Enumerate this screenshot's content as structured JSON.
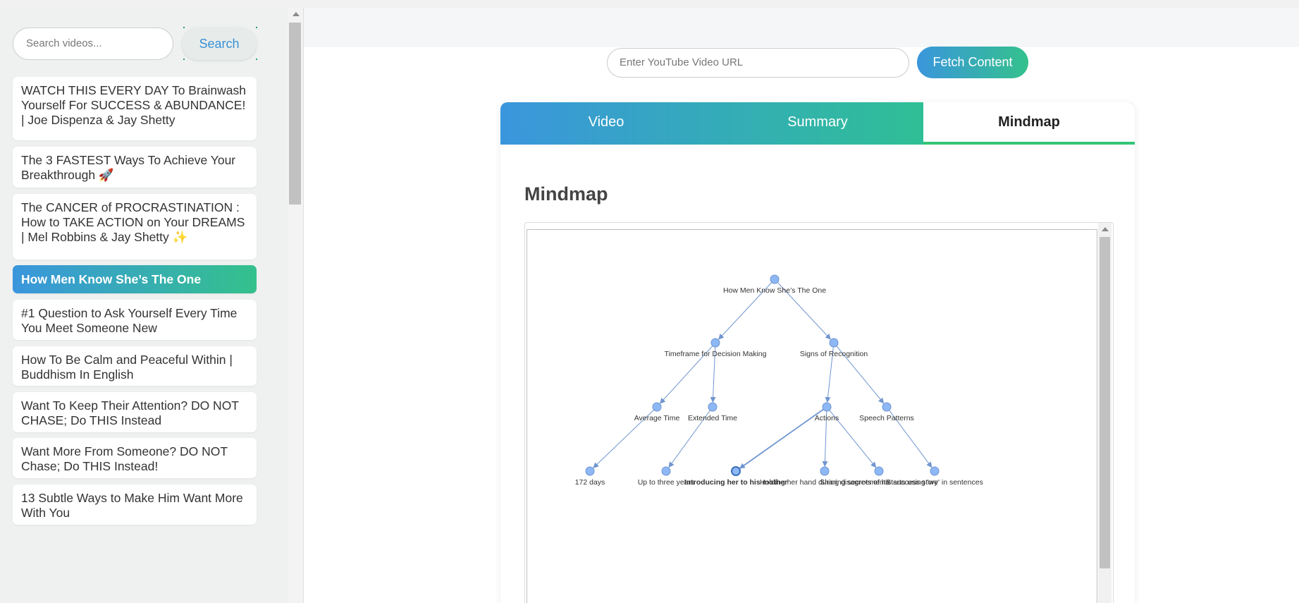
{
  "sidebar": {
    "search_placeholder": "Search videos...",
    "search_label": "Search",
    "videos": [
      "WATCH THIS EVERY DAY To Brainwash Yourself For SUCCESS & ABUNDANCE! | Joe Dispenza & Jay Shetty",
      "The 3 FASTEST Ways To Achieve Your Breakthrough 🚀",
      "The CANCER of PROCRASTINATION : How to TAKE ACTION on Your DREAMS | Mel Robbins & Jay Shetty ✨",
      "How Men Know She’s The One",
      "#1 Question to Ask Yourself Every Time You Meet Someone New",
      "How To Be Calm and Peaceful Within | Buddhism In English",
      "Want To Keep Their Attention? DO NOT CHASE; Do THIS Instead",
      "Want More From Someone? DO NOT Chase; Do THIS Instead!",
      "13 Subtle Ways to Make Him Want More With You"
    ],
    "active_index": 3
  },
  "main": {
    "url_placeholder": "Enter YouTube Video URL",
    "fetch_label": "Fetch Content",
    "tabs": [
      "Video",
      "Summary",
      "Mindmap"
    ],
    "active_tab": "Mindmap",
    "section_title": "Mindmap"
  },
  "mindmap": {
    "root": "How Men Know She’s The One",
    "branches": [
      {
        "label": "Timeframe for Decision Making",
        "children": [
          {
            "label": "Average Time",
            "children": [
              "172 days"
            ]
          },
          {
            "label": "Extended Time",
            "children": [
              "Up to three years"
            ]
          }
        ]
      },
      {
        "label": "Signs of Recognition",
        "children": [
          {
            "label": "Actions",
            "children": [
              "Introducing her to his mother",
              "Holding her hand during disagreements",
              "Sharing secrets of his success story"
            ]
          },
          {
            "label": "Speech Patterns",
            "children": [
              "Starts using 'we' in sentences"
            ]
          }
        ]
      }
    ],
    "highlighted_leaf": "Introducing her to his mother"
  },
  "colors": {
    "accent_start": "#3a96dd",
    "accent_end": "#34c18c",
    "node_fill": "#8db8f5",
    "edge": "#6f95cf"
  }
}
